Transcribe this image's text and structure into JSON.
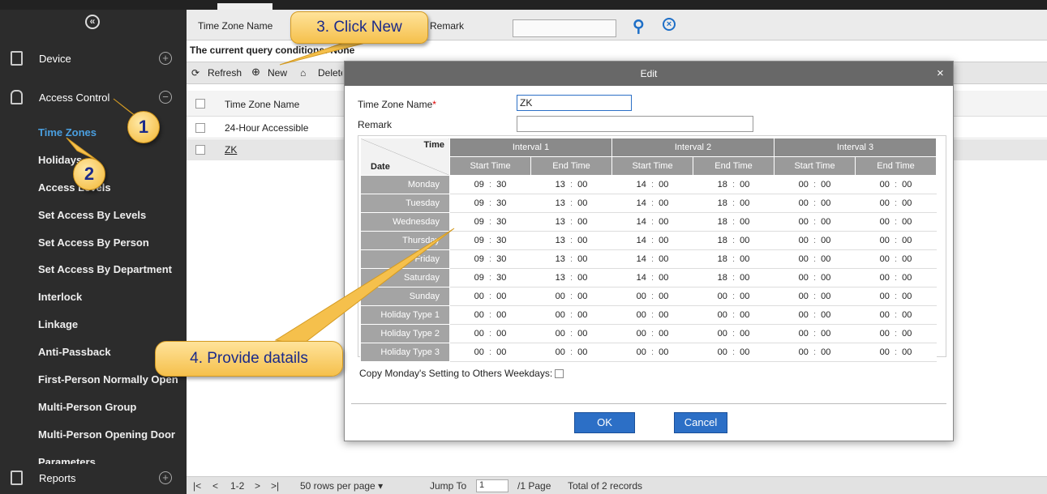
{
  "sidebar": {
    "collapse_glyph": "«",
    "device": {
      "label": "Device",
      "icon": "device-icon"
    },
    "access_control": {
      "label": "Access Control",
      "icon": "lock-icon"
    },
    "items": [
      "Time Zones",
      "Holidays",
      "Access Levels",
      "Set Access By Levels",
      "Set Access By Person",
      "Set Access By Department",
      "Interlock",
      "Linkage",
      "Anti-Passback",
      "First-Person Normally Open",
      "Multi-Person Group",
      "Multi-Person Opening Door",
      "Parameters"
    ],
    "reports": {
      "label": "Reports",
      "icon": "reports-icon"
    }
  },
  "query": {
    "name_label": "Time Zone Name",
    "remark_label": "Remark",
    "conditions": "The current query conditions: None"
  },
  "toolbar": {
    "refresh": "Refresh",
    "new": "New",
    "delete": "Delete"
  },
  "grid": {
    "header": "Time Zone Name",
    "rows": [
      "24-Hour Accessible",
      "ZK"
    ]
  },
  "pager": {
    "range": "1-2",
    "rows_per_page": "50 rows per page",
    "jump_to": "Jump To",
    "page_value": "1",
    "page_total": "/1 Page",
    "total": "Total of 2 records"
  },
  "dialog": {
    "title": "Edit",
    "close": "×",
    "name_label": "Time Zone Name",
    "required_mark": "*",
    "name_value": "ZK",
    "remark_label": "Remark",
    "remark_value": "",
    "corner_time": "Time",
    "corner_date": "Date",
    "intervals": [
      "Interval 1",
      "Interval 2",
      "Interval 3"
    ],
    "start_label": "Start Time",
    "end_label": "End Time",
    "days": [
      {
        "name": "Monday",
        "times": [
          [
            "09",
            "30"
          ],
          [
            "13",
            "00"
          ],
          [
            "14",
            "00"
          ],
          [
            "18",
            "00"
          ],
          [
            "00",
            "00"
          ],
          [
            "00",
            "00"
          ]
        ]
      },
      {
        "name": "Tuesday",
        "times": [
          [
            "09",
            "30"
          ],
          [
            "13",
            "00"
          ],
          [
            "14",
            "00"
          ],
          [
            "18",
            "00"
          ],
          [
            "00",
            "00"
          ],
          [
            "00",
            "00"
          ]
        ]
      },
      {
        "name": "Wednesday",
        "times": [
          [
            "09",
            "30"
          ],
          [
            "13",
            "00"
          ],
          [
            "14",
            "00"
          ],
          [
            "18",
            "00"
          ],
          [
            "00",
            "00"
          ],
          [
            "00",
            "00"
          ]
        ]
      },
      {
        "name": "Thursday",
        "times": [
          [
            "09",
            "30"
          ],
          [
            "13",
            "00"
          ],
          [
            "14",
            "00"
          ],
          [
            "18",
            "00"
          ],
          [
            "00",
            "00"
          ],
          [
            "00",
            "00"
          ]
        ]
      },
      {
        "name": "Friday",
        "times": [
          [
            "09",
            "30"
          ],
          [
            "13",
            "00"
          ],
          [
            "14",
            "00"
          ],
          [
            "18",
            "00"
          ],
          [
            "00",
            "00"
          ],
          [
            "00",
            "00"
          ]
        ]
      },
      {
        "name": "Saturday",
        "times": [
          [
            "09",
            "30"
          ],
          [
            "13",
            "00"
          ],
          [
            "14",
            "00"
          ],
          [
            "18",
            "00"
          ],
          [
            "00",
            "00"
          ],
          [
            "00",
            "00"
          ]
        ]
      },
      {
        "name": "Sunday",
        "times": [
          [
            "00",
            "00"
          ],
          [
            "00",
            "00"
          ],
          [
            "00",
            "00"
          ],
          [
            "00",
            "00"
          ],
          [
            "00",
            "00"
          ],
          [
            "00",
            "00"
          ]
        ]
      },
      {
        "name": "Holiday Type 1",
        "times": [
          [
            "00",
            "00"
          ],
          [
            "00",
            "00"
          ],
          [
            "00",
            "00"
          ],
          [
            "00",
            "00"
          ],
          [
            "00",
            "00"
          ],
          [
            "00",
            "00"
          ]
        ]
      },
      {
        "name": "Holiday Type 2",
        "times": [
          [
            "00",
            "00"
          ],
          [
            "00",
            "00"
          ],
          [
            "00",
            "00"
          ],
          [
            "00",
            "00"
          ],
          [
            "00",
            "00"
          ],
          [
            "00",
            "00"
          ]
        ]
      },
      {
        "name": "Holiday Type 3",
        "times": [
          [
            "00",
            "00"
          ],
          [
            "00",
            "00"
          ],
          [
            "00",
            "00"
          ],
          [
            "00",
            "00"
          ],
          [
            "00",
            "00"
          ],
          [
            "00",
            "00"
          ]
        ]
      }
    ],
    "copy_label": "Copy Monday's Setting to Others Weekdays:",
    "ok": "OK",
    "cancel": "Cancel"
  },
  "callouts": {
    "step1": "1",
    "step2": "2",
    "step3": "3. Click New",
    "step4": "4. Provide datails"
  },
  "colors": {
    "accent": "#2c6fc6",
    "sidebar": "#2c2c2c",
    "active_item": "#4a9fe0",
    "callout": "#f5c04c"
  }
}
